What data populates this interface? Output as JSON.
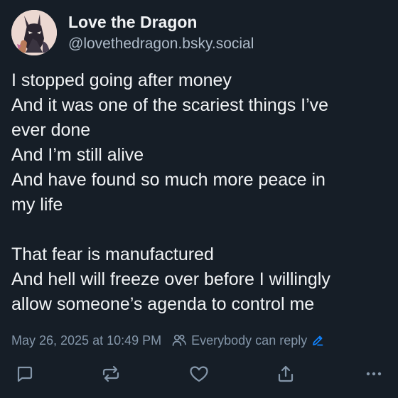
{
  "author": {
    "display_name": "Love the Dragon",
    "handle": "@lovethedragon.bsky.social",
    "avatar_icon": "dragon-avatar"
  },
  "post": {
    "lines": [
      "I stopped going after money",
      "And it was one of the scariest things I’ve",
      "ever done",
      "And I’m still alive",
      "And have found so much more peace in",
      "my life",
      "",
      "That fear is manufactured",
      "And hell will freeze over before I willingly",
      "allow someone’s agenda to control me"
    ],
    "timestamp": "May 26, 2025 at 10:49 PM",
    "reply_setting": "Everybody can reply"
  },
  "actions": [
    {
      "name": "reply",
      "icon": "reply-icon"
    },
    {
      "name": "repost",
      "icon": "repost-icon"
    },
    {
      "name": "like",
      "icon": "heart-icon"
    },
    {
      "name": "share",
      "icon": "share-icon"
    },
    {
      "name": "more",
      "icon": "more-icon"
    }
  ],
  "colors": {
    "background": "#161e27",
    "text": "#f1f3f5",
    "muted": "#8496a9",
    "accent": "#1083fe"
  }
}
